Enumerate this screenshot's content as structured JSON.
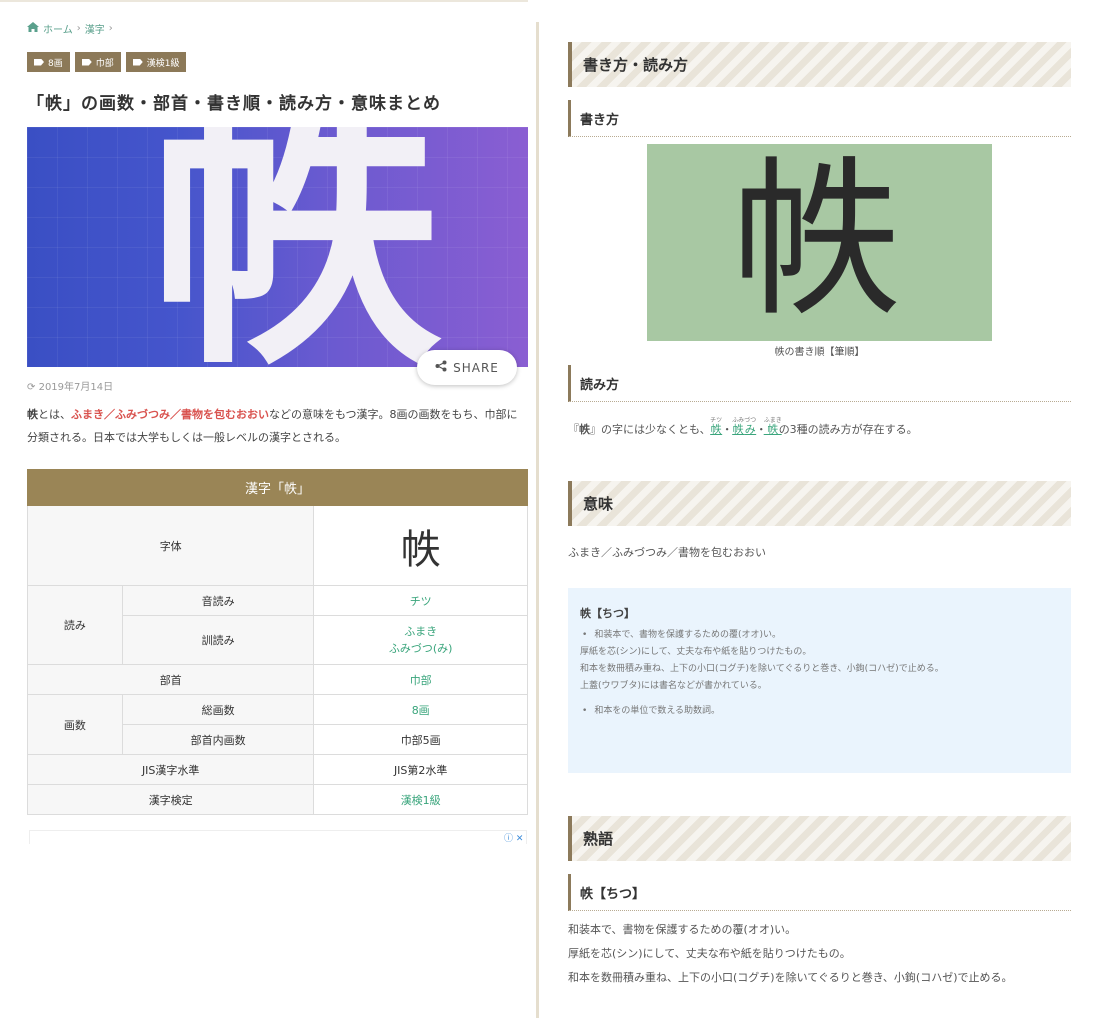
{
  "breadcrumb": {
    "home": "ホーム",
    "category": "漢字"
  },
  "tags": [
    "8画",
    "巾部",
    "漢検1級"
  ],
  "article": {
    "title": "「帙」の画数・部首・書き順・読み方・意味まとめ",
    "hero_char": "帙",
    "share_label": "SHARE",
    "date": "2019年7月14日",
    "lead": {
      "kanji": "帙",
      "intro": "とは、",
      "meaning": "ふまき／ふみづつみ／書物を包むおおい",
      "rest": "などの意味をもつ漢字。8画の画数をもち、巾部に分類される。日本では大学もしくは一般レベルの漢字とされる。"
    }
  },
  "info_table": {
    "header": "漢字「帙」",
    "jitai_label": "字体",
    "jitai_value": "帙",
    "yomi_label": "読み",
    "on_label": "音読み",
    "on_value": "チツ",
    "kun_label": "訓読み",
    "kun_value_1": "ふまき",
    "kun_value_2": "ふみづつ(み)",
    "bushu_label": "部首",
    "bushu_value": "巾部",
    "kakusu_label": "画数",
    "total_label": "総画数",
    "total_value": "8画",
    "inner_label": "部首内画数",
    "inner_value": "巾部5画",
    "jis_label": "JIS漢字水準",
    "jis_value": "JIS第2水準",
    "kentei_label": "漢字検定",
    "kentei_value": "漢検1級"
  },
  "ad_icons": "ⓘ ✕",
  "right": {
    "h2_kakikata_yomikata": "書き方・読み方",
    "h3_kakikata": "書き方",
    "stroke_char": "帙",
    "stroke_caption": "帙の書き順【筆順】",
    "h3_yomikata": "読み方",
    "reading": {
      "prefix": "『",
      "kanji": "帙",
      "mid": "』の字には少なくとも、",
      "r1_base": "帙",
      "r1_ruby": "チツ",
      "sep1": "・",
      "r2_base": "帙",
      "r2_okuri": "み",
      "r2_ruby": "ふみづつ",
      "sep2": "・",
      "r3_base": "帙",
      "r3_ruby": "ふまき",
      "suffix": "の3種の読み方が存在する。"
    },
    "h2_imi": "意味",
    "imi_text": "ふまき／ふみづつみ／書物を包むおおい",
    "dict": {
      "title": "帙【ちつ】",
      "line1": "和装本で、書物を保護するための覆(オオ)い。",
      "line2": "厚紙を芯(シン)にして、丈夫な布や紙を貼りつけたもの。",
      "line3": "和本を数冊積み重ね、上下の小口(コグチ)を除いてぐるりと巻き、小鉤(コハゼ)で止める。",
      "line4": "上蓋(ウワブタ)には書名などが書かれている。",
      "line5": "和本をの単位で数える助数詞。"
    },
    "h2_jukugo": "熟語",
    "h3_jukugo": "帙【ちつ】",
    "jukugo_line1": "和装本で、書物を保護するための覆(オオ)い。",
    "jukugo_line2": "厚紙を芯(シン)にして、丈夫な布や紙を貼りつけたもの。",
    "jukugo_line3": "和本を数冊積み重ね、上下の小口(コグチ)を除いてぐるりと巻き、小鉤(コハゼ)で止める。"
  },
  "colors": {
    "accent_brown": "#8c7958",
    "link_green": "#3aa57c",
    "highlight_red": "#d9534f",
    "dict_bg": "#eaf4fd",
    "stroke_bg": "#a8c8a3"
  }
}
